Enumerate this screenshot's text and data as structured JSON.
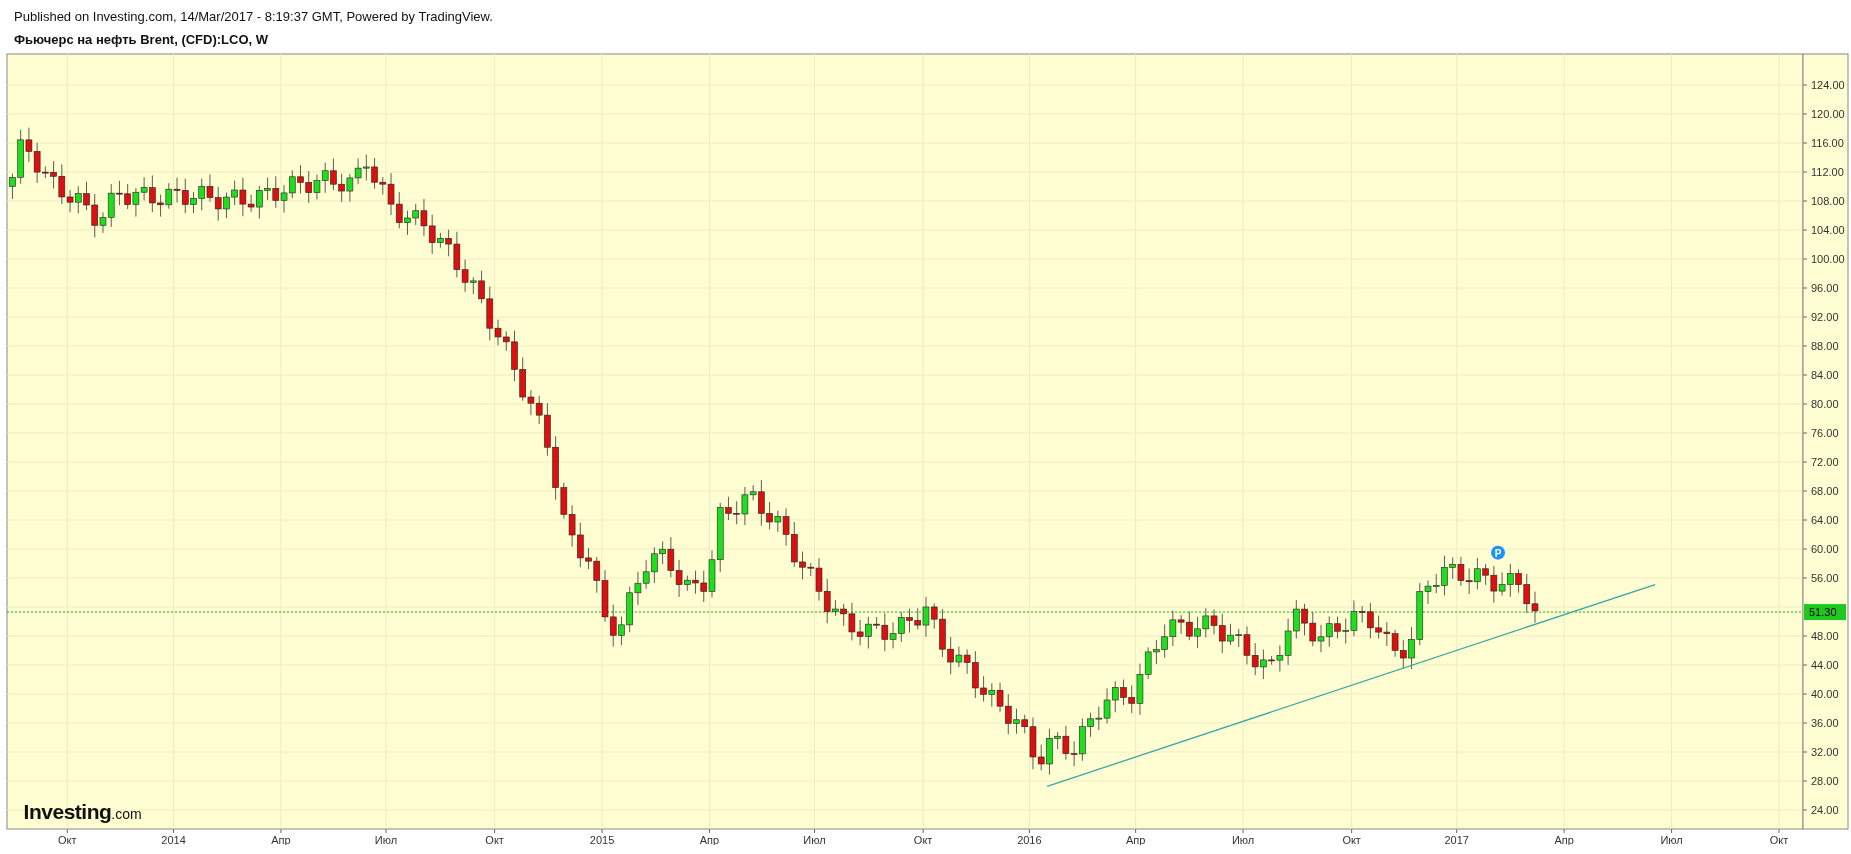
{
  "header": {
    "published": "Published on Investing.com, 14/Mar/2017 - 8:19:37 GMT, Powered by TradingView.",
    "title": "Фьючерс на нефть Brent, (CFD):LCO, W"
  },
  "chart": {
    "y_axis_labels": [
      "124.00",
      "120.00",
      "116.00",
      "112.00",
      "108.00",
      "104.00",
      "100.00",
      "96.00",
      "92.00",
      "88.00",
      "84.00",
      "80.00",
      "76.00",
      "72.00",
      "68.00",
      "64.00",
      "60.00",
      "56.00",
      "48.00",
      "44.00",
      "40.00",
      "36.00",
      "32.00",
      "28.00",
      "24.00"
    ],
    "x_axis_labels": [
      "Окт",
      "2014",
      "Апр",
      "Июл",
      "Окт",
      "2015",
      "Апр",
      "Июл",
      "Окт",
      "2016",
      "Апр",
      "Июл",
      "Окт",
      "2017",
      "Апр",
      "Июл",
      "Окт"
    ],
    "current_price": "51.30",
    "marker": "P",
    "logo": {
      "main": "Investing",
      "suffix": ".com"
    }
  }
}
